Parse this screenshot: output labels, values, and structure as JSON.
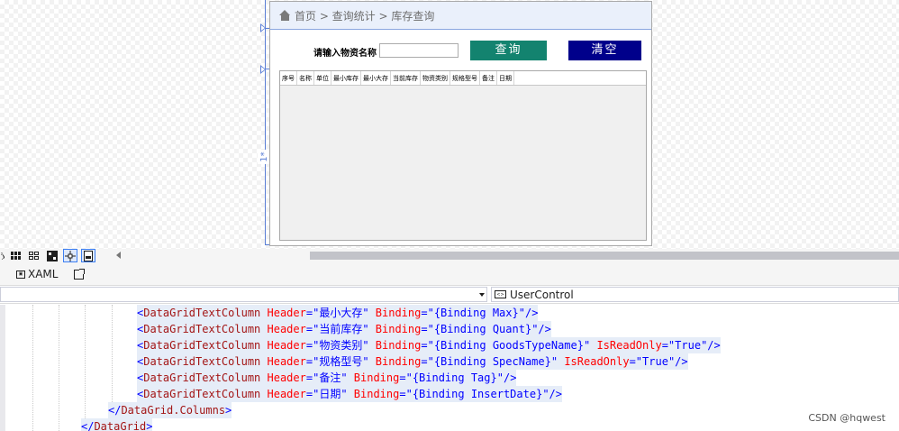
{
  "designer": {
    "row_size": "1*",
    "breadcrumb": "首页 > 查询统计 > 库存查询",
    "search": {
      "label": "请输入物资名称",
      "value": "",
      "query_button": "查询",
      "clear_button": "清空"
    },
    "grid": {
      "columns": [
        "序号",
        "名称",
        "单位",
        "最小库存",
        "最小大存",
        "当前库存",
        "物资类别",
        "规格型号",
        "备注",
        "日期"
      ]
    }
  },
  "toolbar": {
    "icons": [
      "fx-icon",
      "grid-icon",
      "snap-grid-icon",
      "artboard-icon",
      "snap-lines-icon",
      "device-icon"
    ]
  },
  "tabs": {
    "xaml_label": "XAML",
    "xaml_glyph": "▣"
  },
  "navbar": {
    "left_value": "",
    "right_value": "UserControl",
    "right_glyph": "<>"
  },
  "code": {
    "lines": [
      {
        "indent": 152,
        "tag": "DataGridTextColumn",
        "header": "最小大存",
        "binding": "{Binding Max}",
        "readonly": "",
        "close": "/>"
      },
      {
        "indent": 152,
        "tag": "DataGridTextColumn",
        "header": "当前库存",
        "binding": "{Binding Quant}",
        "readonly": "",
        "close": "/>"
      },
      {
        "indent": 152,
        "tag": "DataGridTextColumn",
        "header": "物资类别",
        "binding": "{Binding GoodsTypeName}",
        "readonly": "True",
        "close": "/>"
      },
      {
        "indent": 152,
        "tag": "DataGridTextColumn",
        "header": "规格型号",
        "binding": "{Binding SpecName}",
        "readonly": "True",
        "close": "/>"
      },
      {
        "indent": 152,
        "tag": "DataGridTextColumn",
        "header": "备注",
        "binding": "{Binding Tag}",
        "readonly": "",
        "close": "/>"
      },
      {
        "indent": 152,
        "tag": "DataGridTextColumn",
        "header": "日期",
        "binding": "{Binding InsertDate}",
        "readonly": "",
        "close": "/>"
      }
    ],
    "closing_lines": [
      {
        "indent": 120,
        "text": "DataGrid.Columns"
      },
      {
        "indent": 90,
        "text": "DataGrid"
      }
    ]
  },
  "watermark": "CSDN @hqwest"
}
